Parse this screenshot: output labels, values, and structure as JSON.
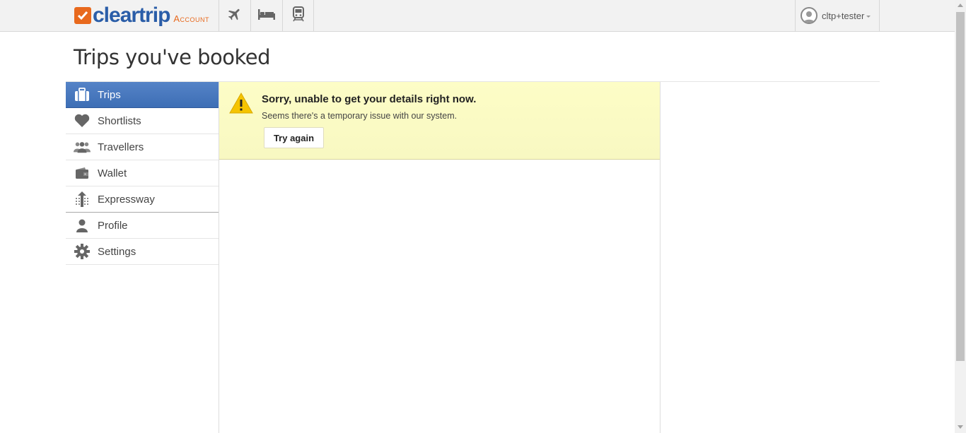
{
  "header": {
    "logo_text": "cleartrip",
    "logo_sub": "Account",
    "nav": [
      {
        "icon": "airplane-icon"
      },
      {
        "icon": "hotel-bed-icon"
      },
      {
        "icon": "train-icon"
      }
    ],
    "user": {
      "name": "cltp+tester"
    }
  },
  "page": {
    "title": "Trips you've booked"
  },
  "sidebar": {
    "items": [
      {
        "label": "Trips",
        "icon": "briefcase-icon",
        "active": true
      },
      {
        "label": "Shortlists",
        "icon": "heart-icon"
      },
      {
        "label": "Travellers",
        "icon": "people-icon"
      },
      {
        "label": "Wallet",
        "icon": "wallet-icon"
      },
      {
        "label": "Expressway",
        "icon": "expressway-icon"
      },
      {
        "label": "Profile",
        "icon": "person-icon"
      },
      {
        "label": "Settings",
        "icon": "gear-icon"
      }
    ]
  },
  "alert": {
    "title": "Sorry, unable to get your details right now.",
    "message": "Seems there's a temporary issue with our system.",
    "button_label": "Try again"
  },
  "colors": {
    "brand_blue": "#2a5da8",
    "brand_orange": "#e8691d",
    "active_nav": "#4a7bc0",
    "alert_bg": "#fdfdc6"
  }
}
